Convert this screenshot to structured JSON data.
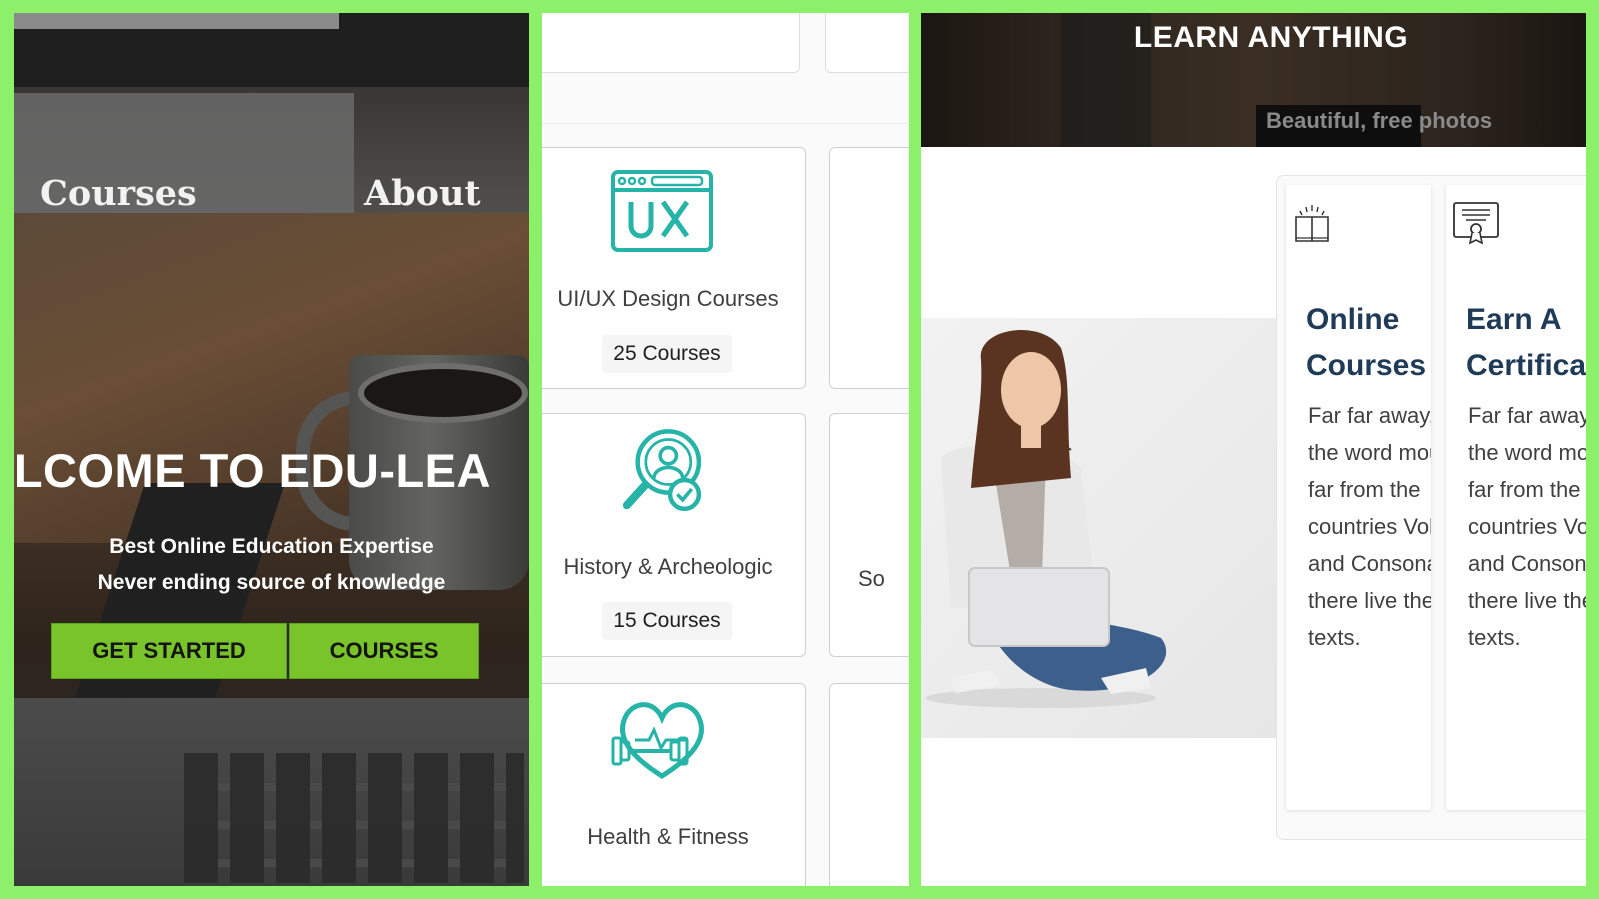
{
  "hero": {
    "nav": {
      "courses": "Courses",
      "about": "About"
    },
    "title": "ELCOME TO EDU-LEA",
    "subtitle_1": "Best Online Education Expertise",
    "subtitle_2": "Never ending source of knowledge",
    "btn_get_started": "GET STARTED",
    "btn_courses": "COURSES"
  },
  "categories": {
    "cards": [
      {
        "title": "UI/UX Design Courses",
        "count": "25 Courses",
        "icon": "ux-icon"
      },
      {
        "title": "History & Archeologic",
        "count": "15 Courses",
        "icon": "search-user-icon"
      },
      {
        "title": "Health & Fitness",
        "count": "",
        "icon": "heart-dumbbell-icon"
      }
    ],
    "side_partial": "So"
  },
  "feature": {
    "banner_title": "LEARN ANYTHING",
    "watermark": "Beautiful, free photos",
    "boxes": [
      {
        "title": "Online Courses",
        "icon": "open-book-icon",
        "text": "Far far away, behind the word mountains, far from the countries Vokalia and Consonantia, there live the blind texts."
      },
      {
        "title": "Earn A Certificate",
        "icon": "certificate-icon",
        "text": "Far far away, behind the word mountains, far from the countries Vokalia and Consonantia, there live the blind texts."
      }
    ]
  },
  "colors": {
    "frame": "#8cf06a",
    "button": "#79c42a",
    "teal": "#26b3a8",
    "heading": "#1f3b57"
  }
}
